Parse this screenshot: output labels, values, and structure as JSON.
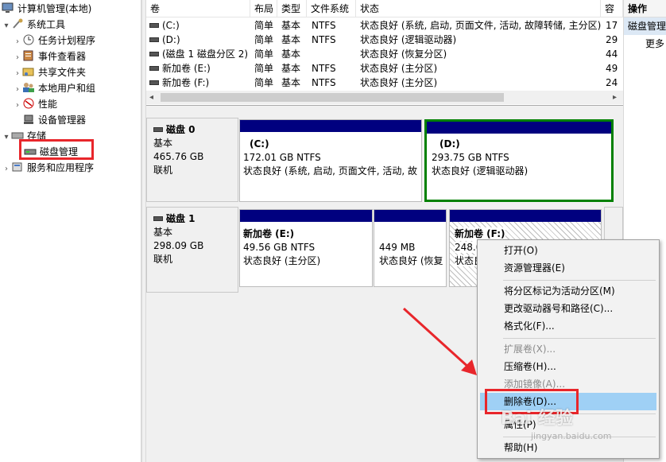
{
  "tree": {
    "items": [
      {
        "label": "计算机管理(本地)",
        "icon": "computer-mgmt-icon",
        "expander": ""
      },
      {
        "label": "系统工具",
        "icon": "tools-icon",
        "expander": "▾"
      },
      {
        "label": "任务计划程序",
        "icon": "clock-icon",
        "expander": "›"
      },
      {
        "label": "事件查看器",
        "icon": "event-log-icon",
        "expander": "›"
      },
      {
        "label": "共享文件夹",
        "icon": "shared-folder-icon",
        "expander": "›"
      },
      {
        "label": "本地用户和组",
        "icon": "users-icon",
        "expander": "›"
      },
      {
        "label": "性能",
        "icon": "performance-icon",
        "expander": "›"
      },
      {
        "label": "设备管理器",
        "icon": "device-manager-icon",
        "expander": ""
      },
      {
        "label": "存储",
        "icon": "storage-icon",
        "expander": "▾"
      },
      {
        "label": "磁盘管理",
        "icon": "disk-icon",
        "expander": ""
      },
      {
        "label": "服务和应用程序",
        "icon": "services-icon",
        "expander": "›"
      }
    ]
  },
  "volume_list": {
    "columns": [
      "卷",
      "布局",
      "类型",
      "文件系统",
      "状态",
      "容"
    ],
    "rows": [
      {
        "volume": "(C:)",
        "layout": "简单",
        "type": "基本",
        "fs": "NTFS",
        "status": "状态良好 (系统, 启动, 页面文件, 活动, 故障转储, 主分区)",
        "capacity": "17"
      },
      {
        "volume": "(D:)",
        "layout": "简单",
        "type": "基本",
        "fs": "NTFS",
        "status": "状态良好 (逻辑驱动器)",
        "capacity": "29"
      },
      {
        "volume": "(磁盘 1 磁盘分区 2)",
        "layout": "简单",
        "type": "基本",
        "fs": "",
        "status": "状态良好 (恢复分区)",
        "capacity": "44"
      },
      {
        "volume": "新加卷 (E:)",
        "layout": "简单",
        "type": "基本",
        "fs": "NTFS",
        "status": "状态良好 (主分区)",
        "capacity": "49"
      },
      {
        "volume": "新加卷 (F:)",
        "layout": "简单",
        "type": "基本",
        "fs": "NTFS",
        "status": "状态良好 (主分区)",
        "capacity": "24"
      }
    ],
    "scroll_left": "◂",
    "scroll_right": "▸"
  },
  "disks": [
    {
      "name": "磁盘 0",
      "kind": "基本",
      "size": "465.76 GB",
      "state": "联机",
      "partitions": [
        {
          "name": "(C:)",
          "size": "172.01 GB NTFS",
          "status": "状态良好 (系统, 启动, 页面文件, 活动, 故"
        },
        {
          "name": "(D:)",
          "size": "293.75 GB NTFS",
          "status": "状态良好 (逻辑驱动器)"
        }
      ]
    },
    {
      "name": "磁盘 1",
      "kind": "基本",
      "size": "298.09 GB",
      "state": "联机",
      "partitions": [
        {
          "name": "新加卷  (E:)",
          "size": "49.56 GB NTFS",
          "status": "状态良好 (主分区)"
        },
        {
          "name": "",
          "size": "449 MB",
          "status": "状态良好 (恢复"
        },
        {
          "name": "新加卷  (F:)",
          "size": "248.0",
          "status": "状态良"
        }
      ]
    }
  ],
  "actions": {
    "header": "操作",
    "selected": "磁盘管理",
    "more": "更多"
  },
  "context_menu": {
    "items": [
      {
        "label": "打开(O)",
        "disabled": false
      },
      {
        "label": "资源管理器(E)",
        "disabled": false
      },
      {
        "label": "将分区标记为活动分区(M)",
        "disabled": false
      },
      {
        "label": "更改驱动器号和路径(C)...",
        "disabled": false
      },
      {
        "label": "格式化(F)...",
        "disabled": false
      },
      {
        "label": "扩展卷(X)...",
        "disabled": true
      },
      {
        "label": "压缩卷(H)...",
        "disabled": false
      },
      {
        "label": "添加镜像(A)...",
        "disabled": true
      },
      {
        "label": "删除卷(D)...",
        "disabled": false,
        "highlighted": true
      },
      {
        "label": "属性(P)",
        "disabled": false
      },
      {
        "label": "帮助(H)",
        "disabled": false
      }
    ]
  },
  "watermark": {
    "text": "Bai 经验",
    "sub": "jingyan.baidu.com"
  },
  "colors": {
    "partition_bar": "#00007f",
    "selected_partition_border": "#008000",
    "annotation_red": "#e8262b",
    "menu_highlight": "#9fd0f5"
  }
}
